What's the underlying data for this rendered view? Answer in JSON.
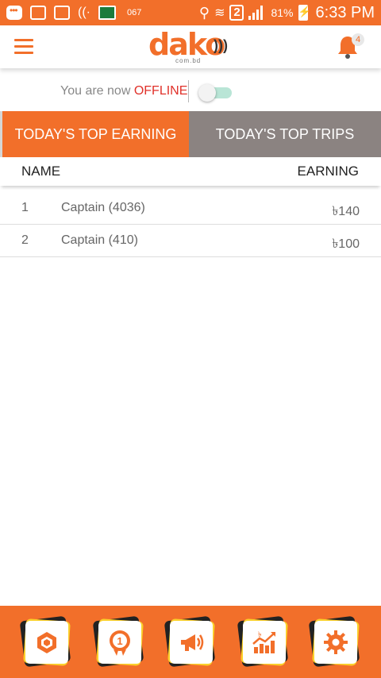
{
  "status_bar": {
    "carrier": "067",
    "sim_badge": "2",
    "battery": "81%",
    "time": "6:33 PM"
  },
  "header": {
    "logo_text": "dako",
    "logo_sub": "com.bd",
    "notification_count": "4"
  },
  "status": {
    "prefix": "You are now",
    "state": "OFFLINE"
  },
  "tabs": [
    {
      "label": "TODAY'S TOP EARNING",
      "active": true
    },
    {
      "label": "TODAY'S TOP TRIPS",
      "active": false
    }
  ],
  "table": {
    "headers": {
      "name": "NAME",
      "earning": "EARNING"
    },
    "rows": [
      {
        "rank": "1",
        "name": "Captain (4036)",
        "earning": "৳140"
      },
      {
        "rank": "2",
        "name": "Captain (410)",
        "earning": "৳100"
      }
    ]
  },
  "bottom_nav": [
    {
      "icon": "hexagon-icon"
    },
    {
      "icon": "medal-icon"
    },
    {
      "icon": "megaphone-icon"
    },
    {
      "icon": "earnings-chart-icon"
    },
    {
      "icon": "gear-icon"
    }
  ],
  "colors": {
    "brand": "#f26f2a",
    "tab_inactive": "#8b8381",
    "offline": "#e0312a",
    "accent_yellow": "#fbd02a"
  }
}
